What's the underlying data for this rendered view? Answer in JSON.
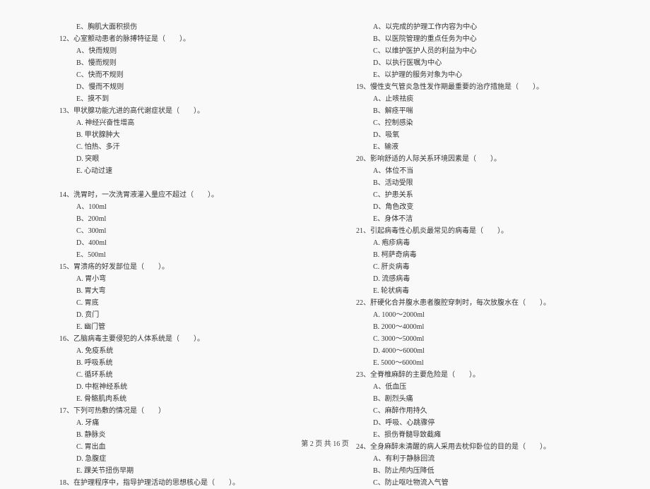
{
  "left_column": [
    {
      "cls": "option-line",
      "text": "E、胸肌大面积损伤"
    },
    {
      "cls": "question-line",
      "text": "12、心室颤动患者的脉搏特征是（　　）。"
    },
    {
      "cls": "option-line",
      "text": "A、快而规则"
    },
    {
      "cls": "option-line",
      "text": "B、慢而规则"
    },
    {
      "cls": "option-line",
      "text": "C、快而不规则"
    },
    {
      "cls": "option-line",
      "text": "D、慢而不规则"
    },
    {
      "cls": "option-line",
      "text": "E、摸不到"
    },
    {
      "cls": "question-line",
      "text": "13、甲状腺功能亢进的高代谢症状是（　　）。"
    },
    {
      "cls": "option-line",
      "text": "A. 神经兴奋性增高"
    },
    {
      "cls": "option-line",
      "text": "B. 甲状腺肿大"
    },
    {
      "cls": "option-line",
      "text": "C. 怕热、多汗"
    },
    {
      "cls": "option-line",
      "text": "D. 突眼"
    },
    {
      "cls": "option-line",
      "text": "E. 心动过速"
    },
    {
      "cls": "question-line",
      "text": "　"
    },
    {
      "cls": "question-line",
      "text": "14、洗胃时，一次洗胃液灌入量应不超过（　　）。"
    },
    {
      "cls": "option-line",
      "text": "A、100ml"
    },
    {
      "cls": "option-line",
      "text": "B、200ml"
    },
    {
      "cls": "option-line",
      "text": "C、300ml"
    },
    {
      "cls": "option-line",
      "text": "D、400ml"
    },
    {
      "cls": "option-line",
      "text": "E、500ml"
    },
    {
      "cls": "question-line",
      "text": "15、胃溃疡的好发部位是（　　）。"
    },
    {
      "cls": "option-line",
      "text": "A. 胃小弯"
    },
    {
      "cls": "option-line",
      "text": "B. 胃大弯"
    },
    {
      "cls": "option-line",
      "text": "C. 胃底"
    },
    {
      "cls": "option-line",
      "text": "D. 贲门"
    },
    {
      "cls": "option-line",
      "text": "E. 幽门管"
    },
    {
      "cls": "question-line",
      "text": "16、乙脑病毒主要侵犯的人体系统是（　　）。"
    },
    {
      "cls": "option-line",
      "text": "A. 免疫系统"
    },
    {
      "cls": "option-line",
      "text": "B. 呼吸系统"
    },
    {
      "cls": "option-line",
      "text": "C. 循环系统"
    },
    {
      "cls": "option-line",
      "text": "D. 中枢神经系统"
    },
    {
      "cls": "option-line",
      "text": "E. 骨骼肌肉系统"
    },
    {
      "cls": "question-line",
      "text": "17、下列可热敷的情况是（　　）"
    },
    {
      "cls": "option-line",
      "text": "A. 牙痛"
    },
    {
      "cls": "option-line",
      "text": "B. 静脉炎"
    },
    {
      "cls": "option-line",
      "text": "C. 胃出血"
    },
    {
      "cls": "option-line",
      "text": "D. 急腹症"
    },
    {
      "cls": "option-line",
      "text": "E. 踝关节扭伤早期"
    },
    {
      "cls": "question-line",
      "text": "18、在护理程序中，指导护理活动的思想核心是（　　）。"
    }
  ],
  "right_column": [
    {
      "cls": "option-line",
      "text": "A、以完成的护理工作内容为中心"
    },
    {
      "cls": "option-line",
      "text": "B、以医院管理的重点任务为中心"
    },
    {
      "cls": "option-line",
      "text": "C、以维护医护人员的利益为中心"
    },
    {
      "cls": "option-line",
      "text": "D、以执行医嘱为中心"
    },
    {
      "cls": "option-line",
      "text": "E、以护理的服务对象为中心"
    },
    {
      "cls": "question-line",
      "text": "19、慢性支气管炎急性发作期最重要的治疗措施是（　　）。"
    },
    {
      "cls": "option-line",
      "text": "A、止咳祛痰"
    },
    {
      "cls": "option-line",
      "text": "B、解痉平喘"
    },
    {
      "cls": "option-line",
      "text": "C、控制感染"
    },
    {
      "cls": "option-line",
      "text": "D、吸氧"
    },
    {
      "cls": "option-line",
      "text": "E、输液"
    },
    {
      "cls": "question-line",
      "text": "20、影响舒适的人际关系环境因素是（　　）。"
    },
    {
      "cls": "option-line",
      "text": "A、体位不当"
    },
    {
      "cls": "option-line",
      "text": "B、活动受限"
    },
    {
      "cls": "option-line",
      "text": "C、护患关系"
    },
    {
      "cls": "option-line",
      "text": "D、角色改变"
    },
    {
      "cls": "option-line",
      "text": "E、身体不洁"
    },
    {
      "cls": "question-line",
      "text": "21、引起病毒性心肌炎最常见的病毒是（　　）。"
    },
    {
      "cls": "option-line",
      "text": "A. 疱疹病毒"
    },
    {
      "cls": "option-line",
      "text": "B. 柯萨奇病毒"
    },
    {
      "cls": "option-line",
      "text": "C. 肝炎病毒"
    },
    {
      "cls": "option-line",
      "text": "D. 流感病毒"
    },
    {
      "cls": "option-line",
      "text": "E. 轮状病毒"
    },
    {
      "cls": "question-line",
      "text": "22、肝硬化合并腹水患者腹腔穿刺时，每次放腹水在（　　）。"
    },
    {
      "cls": "option-line",
      "text": "A. 1000～2000ml"
    },
    {
      "cls": "option-line",
      "text": "B. 2000～4000ml"
    },
    {
      "cls": "option-line",
      "text": "C. 3000～5000ml"
    },
    {
      "cls": "option-line",
      "text": "D. 4000～6000ml"
    },
    {
      "cls": "option-line",
      "text": "E. 5000～6000ml"
    },
    {
      "cls": "question-line",
      "text": "23、全脊椎麻醉的主要危险是（　　）。"
    },
    {
      "cls": "option-line",
      "text": "A、低血压"
    },
    {
      "cls": "option-line",
      "text": "B、剧烈头痛"
    },
    {
      "cls": "option-line",
      "text": "C、麻醉作用持久"
    },
    {
      "cls": "option-line",
      "text": "D、呼吸、心跳骤停"
    },
    {
      "cls": "option-line",
      "text": "E、损伤脊髓导致截瘫"
    },
    {
      "cls": "question-line",
      "text": "24、全身麻醉未清醒的病人采用去枕仰卧位的目的是（　　）。"
    },
    {
      "cls": "option-line",
      "text": "A、有利于静脉回流"
    },
    {
      "cls": "option-line",
      "text": "B、防止颅内压降低"
    },
    {
      "cls": "option-line",
      "text": "C、防止呕吐物流入气管"
    }
  ],
  "footer": "第 2 页 共 16 页"
}
